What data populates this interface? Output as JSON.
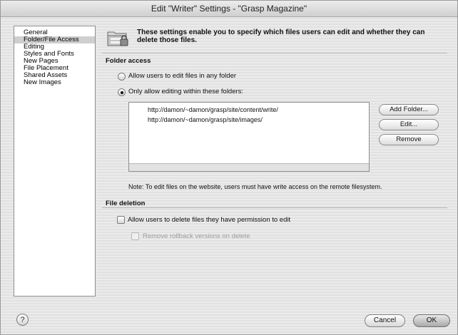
{
  "window": {
    "title": "Edit \"Writer\" Settings - \"Grasp Magazine\""
  },
  "sidebar": {
    "items": [
      {
        "label": "General",
        "selected": false
      },
      {
        "label": "Folder/File Access",
        "selected": true
      },
      {
        "label": "Editing",
        "selected": false
      },
      {
        "label": "Styles and Fonts",
        "selected": false
      },
      {
        "label": "New Pages",
        "selected": false
      },
      {
        "label": "File Placement",
        "selected": false
      },
      {
        "label": "Shared Assets",
        "selected": false
      },
      {
        "label": "New Images",
        "selected": false
      }
    ]
  },
  "header": {
    "icon": "folder-lock-icon",
    "description": "These settings enable you to specify which files users can edit and whether they can delete those files."
  },
  "folder_access": {
    "section_label": "Folder access",
    "option_any": "Allow users to edit files in any folder",
    "option_within": "Only allow editing within these folders:",
    "selected_option": "option_within",
    "folders": [
      "http://damon/~damon/grasp/site/content/write/",
      "http://damon/~damon/grasp/site/images/"
    ],
    "add_button": "Add Folder...",
    "edit_button": "Edit...",
    "remove_button": "Remove",
    "note": "Note: To edit files on the website, users must have write access on the remote filesystem."
  },
  "file_deletion": {
    "section_label": "File deletion",
    "allow_delete": "Allow users to delete files they have permission to edit",
    "allow_delete_checked": false,
    "remove_rollback": "Remove rollback versions on delete",
    "remove_rollback_checked": false,
    "remove_rollback_enabled": false
  },
  "footer": {
    "help_glyph": "?",
    "cancel_button": "Cancel",
    "ok_button": "OK"
  }
}
